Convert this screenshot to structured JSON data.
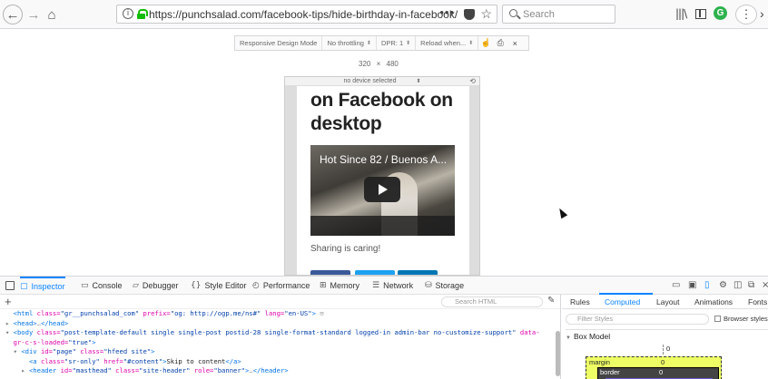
{
  "browser": {
    "url": "https://punchsalad.com/facebook-tips/hide-birthday-in-facebook/",
    "search_placeholder": "Search",
    "extension_letter": "G"
  },
  "rdm": {
    "items": [
      {
        "label": "Responsive Design Mode",
        "caret": false
      },
      {
        "label": "No throttling",
        "caret": true
      },
      {
        "label": "DPR: 1",
        "caret": true
      },
      {
        "label": "Reload when...",
        "caret": true
      }
    ],
    "width": "320",
    "times": "×",
    "height": "480",
    "device_label": "no device selected"
  },
  "page": {
    "post_title": "on Facebook on desktop",
    "video_title": "Hot Since 82 / Buenos A...",
    "sharing_text": "Sharing is caring!",
    "share_colors": [
      "#3b5998",
      "#1da1f2",
      "#0077b5"
    ]
  },
  "devtools": {
    "tabs": [
      {
        "label": "Inspector",
        "icon": "inspector-icon",
        "glyph": "▢",
        "active": true
      },
      {
        "label": "Console",
        "icon": "console-icon",
        "glyph": "▭",
        "active": false
      },
      {
        "label": "Debugger",
        "icon": "debugger-icon",
        "glyph": "▱",
        "active": false
      },
      {
        "label": "Style Editor",
        "icon": "style-editor-icon",
        "glyph": "{}",
        "active": false
      },
      {
        "label": "Performance",
        "icon": "performance-icon",
        "glyph": "◴",
        "active": false
      },
      {
        "label": "Memory",
        "icon": "memory-icon",
        "glyph": "⊞",
        "active": false
      },
      {
        "label": "Network",
        "icon": "network-icon",
        "glyph": "☰",
        "active": false
      },
      {
        "label": "Storage",
        "icon": "storage-icon",
        "glyph": "⛁",
        "active": false
      }
    ],
    "search_html_placeholder": "Search HTML",
    "side_tabs": [
      "Rules",
      "Computed",
      "Layout",
      "Animations",
      "Fonts"
    ],
    "active_side_tab": "Computed",
    "filter_placeholder": "Filter Styles",
    "browser_styles_label": "Browser styles",
    "box_model_label": "Box Model",
    "box_model": {
      "top_value": "0",
      "margin_label": "margin",
      "margin_value": "0",
      "border_label": "border",
      "border_value": "0"
    },
    "markup_lines": [
      {
        "indent": 0,
        "tri": "",
        "segments": [
          [
            "tag",
            "<html "
          ],
          [
            "attr",
            "class="
          ],
          [
            "val",
            "\"gr__punchsalad_com\""
          ],
          [
            "attr",
            " prefix="
          ],
          [
            "val",
            "\"og: http://ogp.me/ns#\""
          ],
          [
            "attr",
            " lang="
          ],
          [
            "val",
            "\"en-US\""
          ],
          [
            "tag",
            ">"
          ],
          [
            "dim",
            " ⊟"
          ]
        ]
      },
      {
        "indent": 0,
        "tri": "▸",
        "segments": [
          [
            "tag",
            "<head>"
          ],
          [
            "dim",
            "…"
          ],
          [
            "tag",
            "</head>"
          ]
        ]
      },
      {
        "indent": 0,
        "tri": "▾",
        "segments": [
          [
            "tag",
            "<body "
          ],
          [
            "attr",
            "class="
          ],
          [
            "val",
            "\"post-template-default single single-post postid-28 single-format-standard logged-in admin-bar no-customize-support\""
          ],
          [
            "attr",
            " data-"
          ]
        ]
      },
      {
        "indent": 0,
        "tri": "",
        "segments": [
          [
            "attr",
            "gr-c-s-loaded="
          ],
          [
            "val",
            "\"true\""
          ],
          [
            "tag",
            ">"
          ]
        ]
      },
      {
        "indent": 1,
        "tri": "▾",
        "segments": [
          [
            "tag",
            "<div "
          ],
          [
            "attr",
            "id="
          ],
          [
            "val",
            "\"page\""
          ],
          [
            "attr",
            " class="
          ],
          [
            "val",
            "\"hfeed site\""
          ],
          [
            "tag",
            ">"
          ]
        ]
      },
      {
        "indent": 2,
        "tri": "",
        "segments": [
          [
            "tag",
            "<a "
          ],
          [
            "attr",
            "class="
          ],
          [
            "val",
            "\"sr-only\""
          ],
          [
            "attr",
            " href="
          ],
          [
            "val",
            "\"#content\""
          ],
          [
            "tag",
            ">"
          ],
          [
            "",
            "Skip to content"
          ],
          [
            "tag",
            "</a>"
          ]
        ]
      },
      {
        "indent": 2,
        "tri": "▸",
        "segments": [
          [
            "tag",
            "<header "
          ],
          [
            "attr",
            "id="
          ],
          [
            "val",
            "\"masthead\""
          ],
          [
            "attr",
            " class="
          ],
          [
            "val",
            "\"site-header\""
          ],
          [
            "attr",
            " role="
          ],
          [
            "val",
            "\"banner\""
          ],
          [
            "tag",
            ">"
          ],
          [
            "dim",
            "…"
          ],
          [
            "tag",
            "</header>"
          ]
        ]
      }
    ]
  }
}
